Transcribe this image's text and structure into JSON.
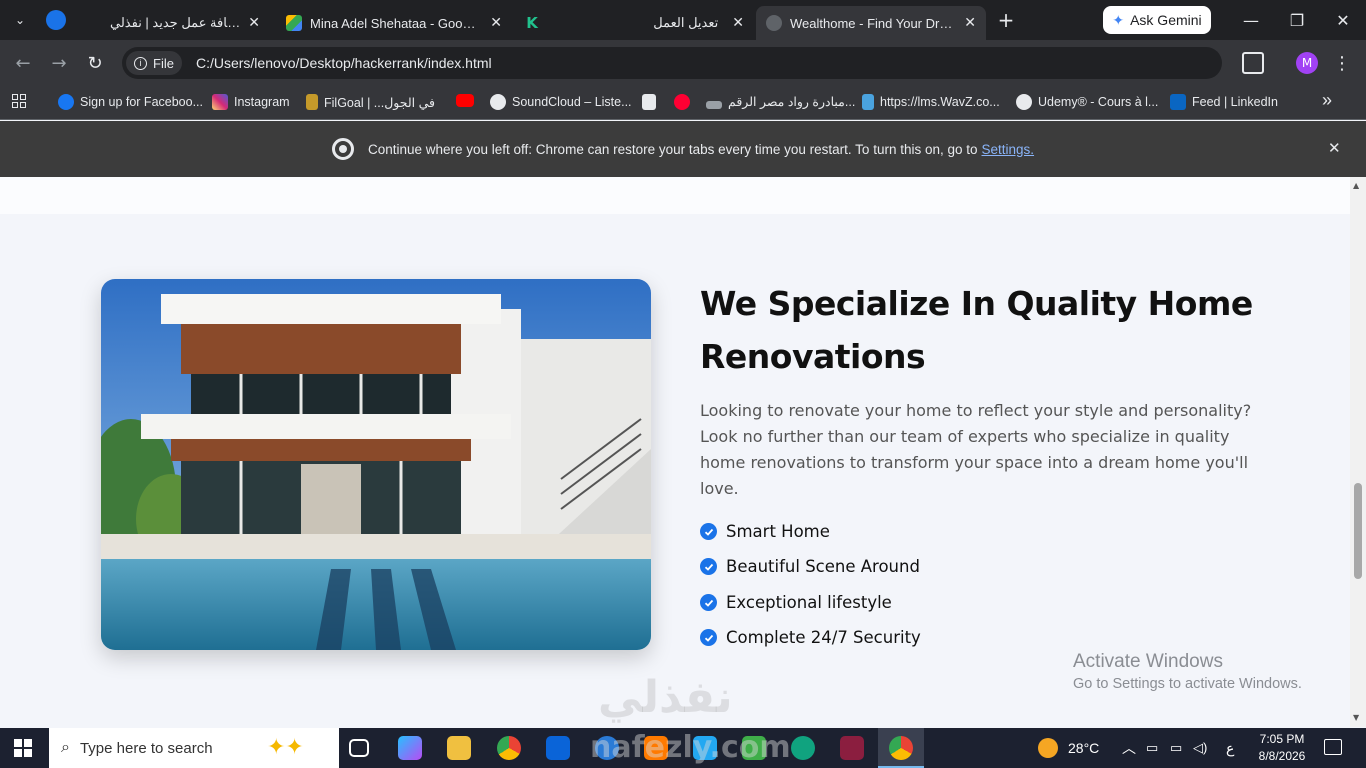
{
  "tabs": [
    {
      "title": "إضافة عمل جديد | نفذلي",
      "active": false
    },
    {
      "title": "Mina Adel Shehataa - Google D",
      "active": false
    },
    {
      "title": "تعديل العمل",
      "active": false
    },
    {
      "title": "Wealthome - Find Your Dream H",
      "active": true
    }
  ],
  "tab_close_glyph": "✕",
  "new_tab_glyph": "+",
  "gemini_label": "Ask Gemini",
  "window_controls": {
    "minimize": "—",
    "restore": "❐",
    "close": "✕"
  },
  "address": {
    "chip_label": "File",
    "url": "C:/Users/lenovo/Desktop/hackerrank/index.html"
  },
  "bookmarks": [
    {
      "label": "Sign up for Faceboo...",
      "icon": "facebook-icon",
      "color": "#1877f2"
    },
    {
      "label": "Instagram",
      "icon": "instagram-icon",
      "color": "#e1306c"
    },
    {
      "label": "FilGoal | ...في الجول",
      "icon": "filgoal-icon",
      "color": "#c59a2a"
    },
    {
      "label": "",
      "icon": "youtube-icon",
      "color": "#ff0000"
    },
    {
      "label": "SoundCloud – Liste...",
      "icon": "globe-icon",
      "color": "#e8eaed"
    },
    {
      "label": "",
      "icon": "document-icon",
      "color": "#e8eaed"
    },
    {
      "label": "",
      "icon": "video-icon",
      "color": "#ff0033"
    },
    {
      "label": "مبادرة رواد مصر الرقم...",
      "icon": "rowad-icon",
      "color": "#9aa0a6"
    },
    {
      "label": "https://lms.WavZ.co...",
      "icon": "lms-icon",
      "color": "#4aa3df"
    },
    {
      "label": "Udemy® - Cours à l...",
      "icon": "globe-icon",
      "color": "#e8eaed"
    },
    {
      "label": "Feed | LinkedIn",
      "icon": "linkedin-icon",
      "color": "#0a66c2"
    }
  ],
  "bookmarks_more": "»",
  "infobar": {
    "message": "Continue where you left off: Chrome can restore your tabs every time you restart. To turn this on, go to",
    "link": "Settings.",
    "close": "✕"
  },
  "content": {
    "heading": "We Specialize In Quality Home Renovations",
    "paragraph": "Looking to renovate your home to reflect your style and personality? Look no further than our team of experts who specialize in quality home renovations to transform your space into a dream home you'll love.",
    "features": [
      "Smart Home",
      "Beautiful Scene Around",
      "Exceptional lifestyle",
      "Complete 24/7 Security"
    ],
    "accent": "#1a73e8"
  },
  "activate_windows": {
    "title": "Activate Windows",
    "subtitle": "Go to Settings to activate Windows."
  },
  "watermarks": {
    "arabic": "نفذلي",
    "latin": "nafezly.com"
  },
  "taskbar": {
    "search_placeholder": "Type here to search",
    "weather": "28°C",
    "lang": "ع",
    "time": "7:05 PM",
    "date": "8/8/2026"
  }
}
